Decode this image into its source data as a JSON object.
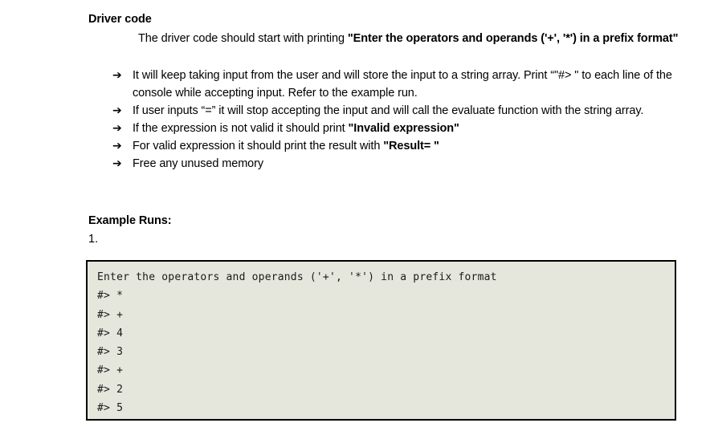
{
  "document": {
    "section_heading": "Driver code",
    "intro_paragraph": {
      "lead": "The driver code should start with printing ",
      "bold_quote": "\"Enter the operators and operands ('+', '*') in a prefix format\""
    },
    "bullets": [
      {
        "arrow": "arrow-right-icon",
        "marker": "➔",
        "text_before": "It will keep taking input from the user and will store the input to a string array. Print “\"#> \" to each line of the console while accepting input. Refer to the example run.",
        "bold": "",
        "text_after": ""
      },
      {
        "arrow": "arrow-right-icon",
        "marker": "➔",
        "text_before": "If user inputs “=” it will stop accepting the input and will call the evaluate function with the string array.",
        "bold": "",
        "text_after": ""
      },
      {
        "arrow": "arrow-right-icon",
        "marker": "➔",
        "text_before": "If the expression is not valid it should print ",
        "bold": "\"Invalid expression\"",
        "text_after": ""
      },
      {
        "arrow": "arrow-right-icon",
        "marker": "➔",
        "text_before": "For valid expression it should print the result with ",
        "bold": "\"Result= \"",
        "text_after": ""
      },
      {
        "arrow": "arrow-right-icon",
        "marker": "➔",
        "text_before": "Free any unused memory",
        "bold": "",
        "text_after": ""
      }
    ],
    "examples_heading": "Example Runs:",
    "example_number": "1.",
    "console": {
      "background_color": "#e6e7dc",
      "border_color": "#000000",
      "lines": [
        "Enter the operators and operands ('+', '*') in a prefix format",
        "#> *",
        "#> +",
        "#> 4",
        "#> 3",
        "#> +",
        "#> 2",
        "#> 5"
      ]
    }
  }
}
